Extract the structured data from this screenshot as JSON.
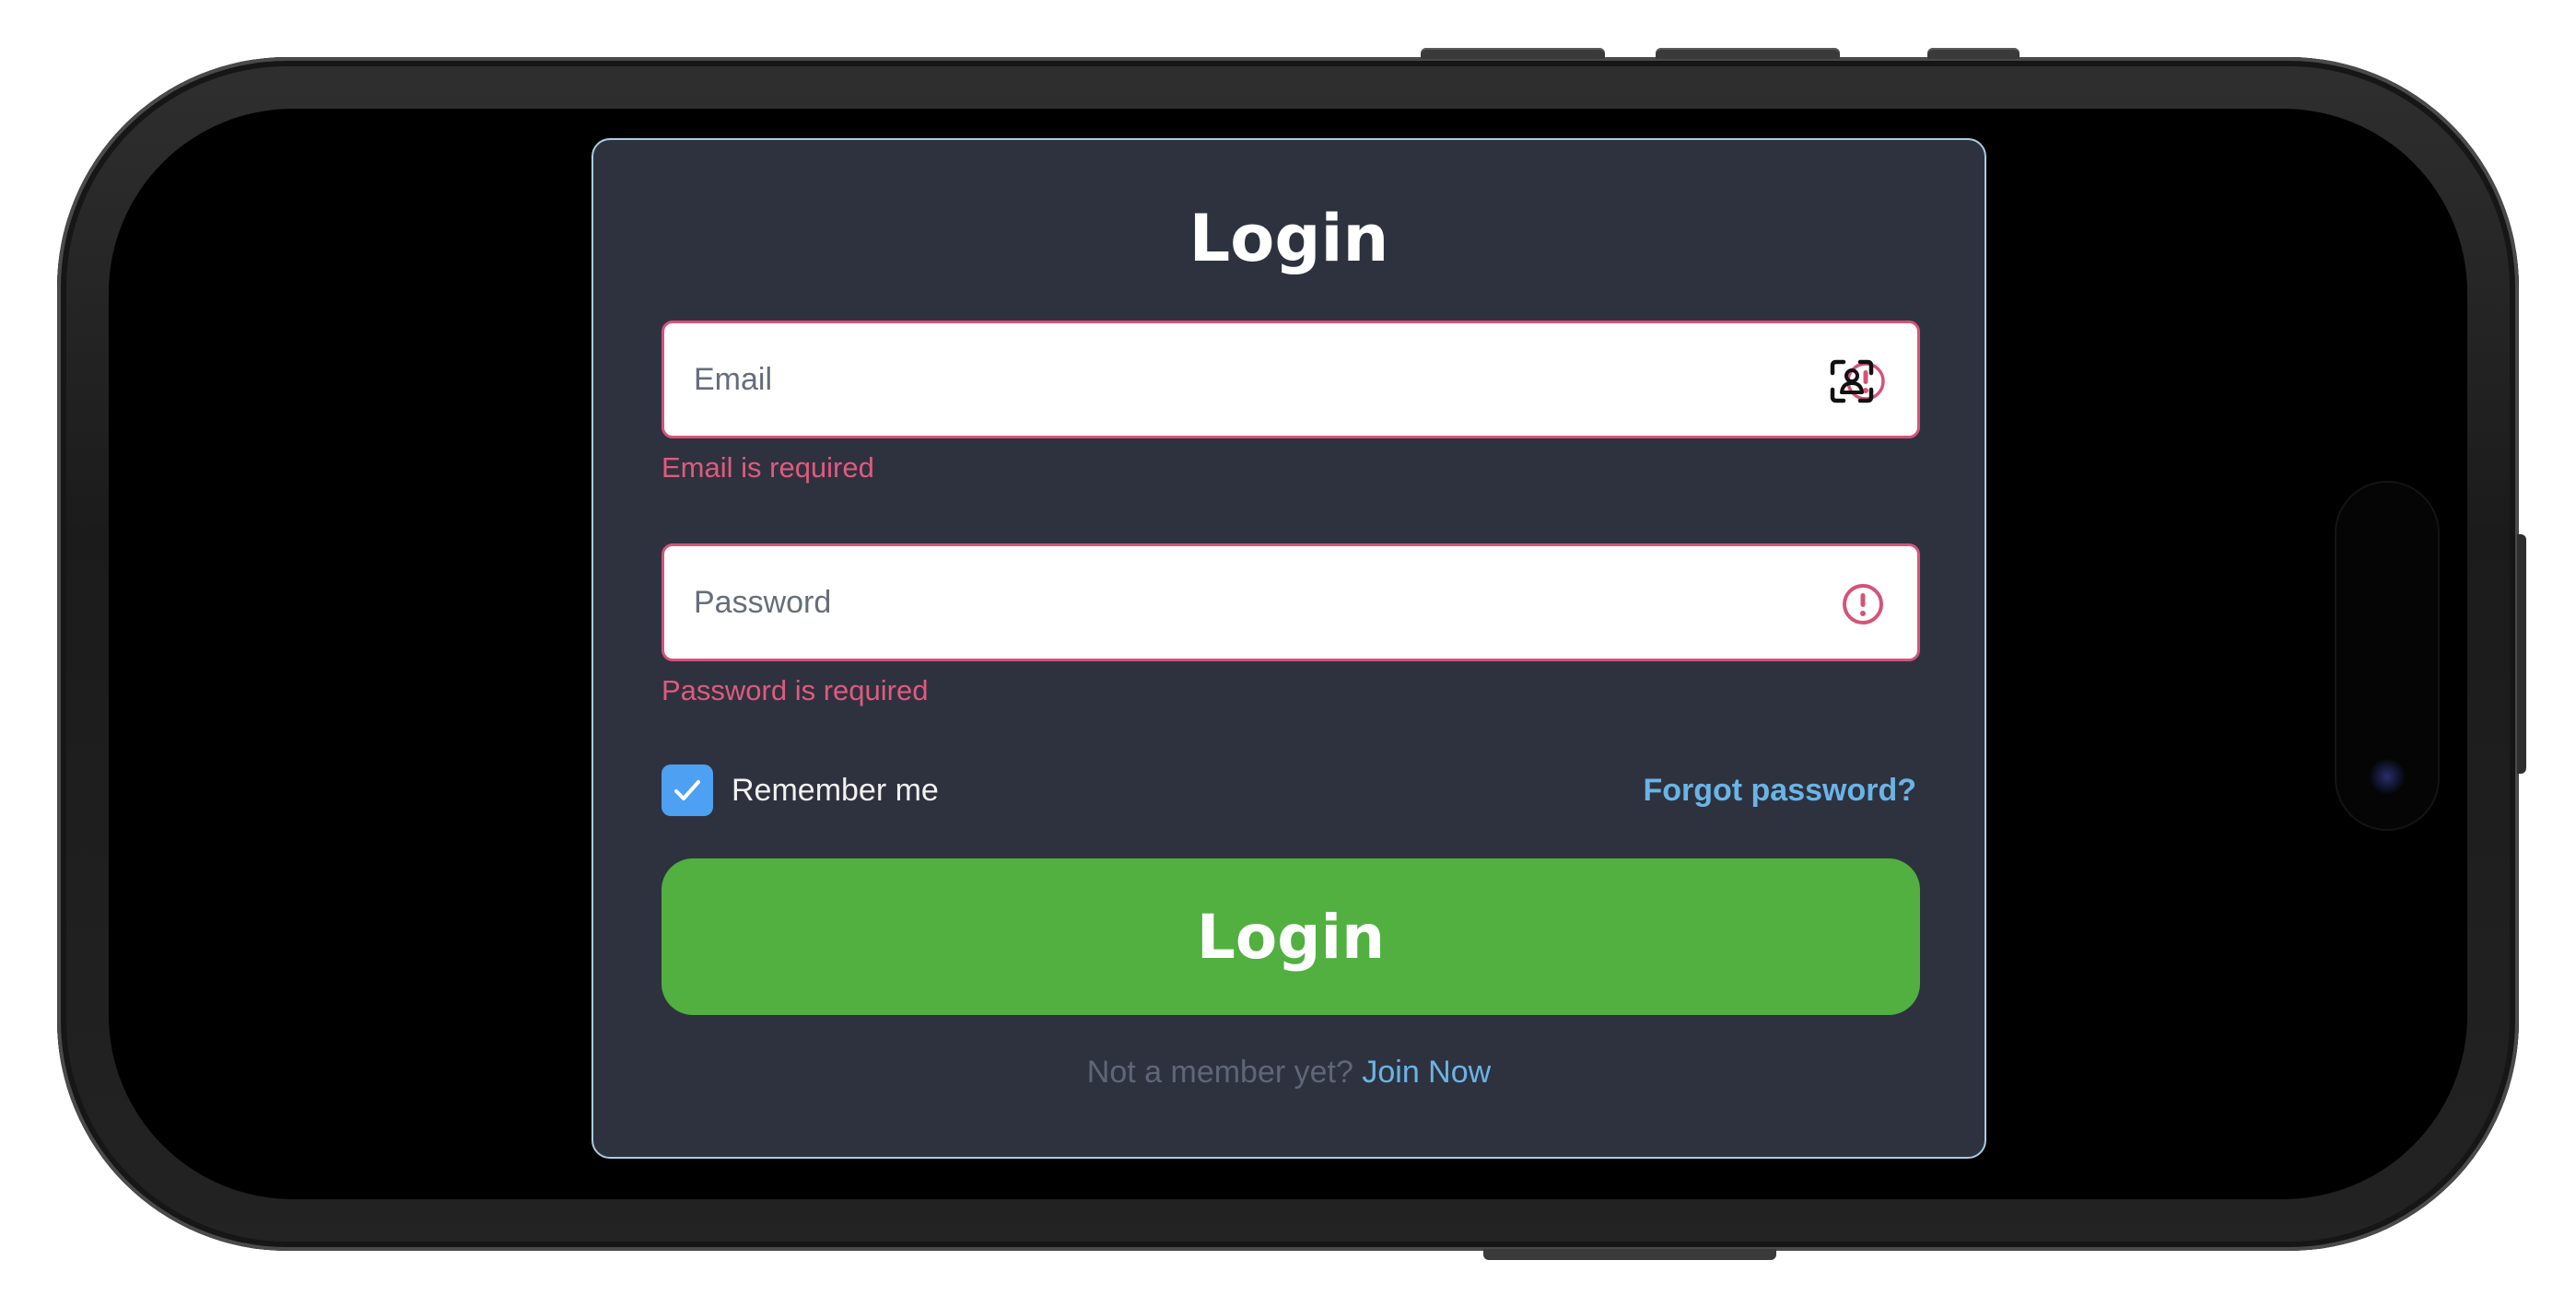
{
  "form": {
    "title": "Login",
    "email": {
      "placeholder": "Email",
      "value": "",
      "error": "Email is required"
    },
    "password": {
      "placeholder": "Password",
      "value": "",
      "error": "Password is required"
    },
    "remember": {
      "label": "Remember me",
      "checked": true
    },
    "forgot_label": "Forgot password?",
    "submit_label": "Login",
    "footer": {
      "prompt": "Not a member yet?",
      "link_label": "Join Now"
    }
  },
  "icons": {
    "email_field": "autofill-contact-icon",
    "email_status": "error-circle-icon",
    "password_status": "error-circle-icon",
    "checkbox": "checkmark-icon"
  },
  "colors": {
    "card_background": "#2e323f",
    "card_border": "#a9cde3",
    "error": "#e05a7f",
    "link": "#6ab4e6",
    "checkbox": "#4ea0f2",
    "submit": "#51b03f"
  }
}
